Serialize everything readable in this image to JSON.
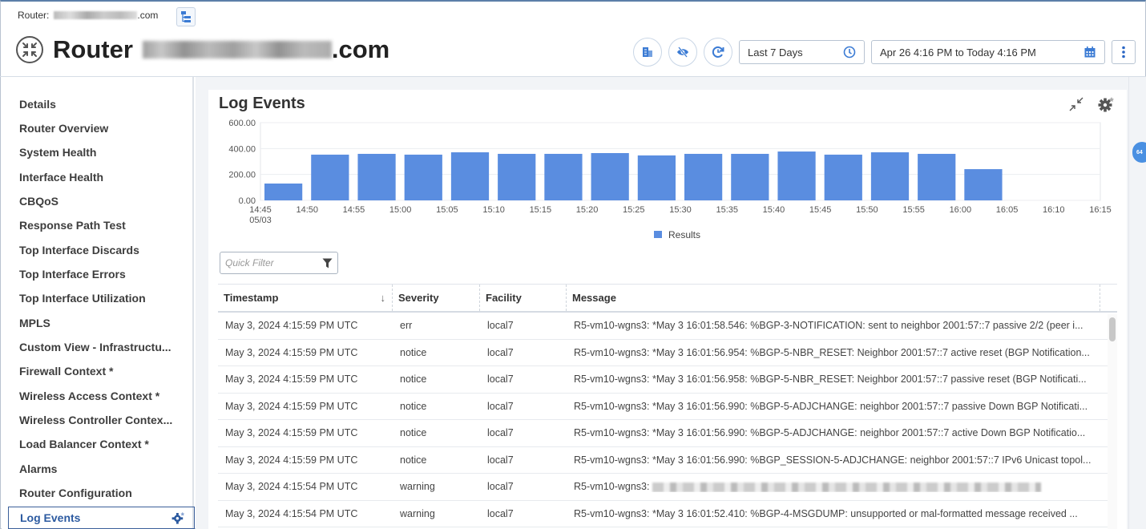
{
  "header": {
    "breadcrumb_prefix": "Router:",
    "breadcrumb_suffix": ".com",
    "title_prefix": "Router",
    "title_suffix": ".com",
    "time_range_select": "Last 7 Days",
    "date_range": "Apr 26 4:16 PM to Today 4:16 PM",
    "icons": [
      "topology-icon",
      "router-icon",
      "report-icon",
      "hide-icon",
      "refresh-schedule-icon",
      "clock-icon",
      "calendar-icon",
      "more-vertical-icon"
    ]
  },
  "sidebar": {
    "items": [
      {
        "label": "Details"
      },
      {
        "label": "Router Overview"
      },
      {
        "label": "System Health"
      },
      {
        "label": "Interface Health"
      },
      {
        "label": "CBQoS"
      },
      {
        "label": "Response Path Test"
      },
      {
        "label": "Top Interface Discards"
      },
      {
        "label": "Top Interface Errors"
      },
      {
        "label": "Top Interface Utilization"
      },
      {
        "label": "MPLS"
      },
      {
        "label": "Custom View - Infrastructu..."
      },
      {
        "label": "Firewall Context *"
      },
      {
        "label": "Wireless Access Context *"
      },
      {
        "label": "Wireless Controller Contex..."
      },
      {
        "label": "Load Balancer Context *"
      },
      {
        "label": "Alarms"
      },
      {
        "label": "Router Configuration"
      },
      {
        "label": "Log Events",
        "active": true
      }
    ]
  },
  "panel": {
    "title": "Log Events",
    "quick_filter_placeholder": "Quick Filter",
    "side_badge": "64"
  },
  "chart_data": {
    "type": "bar",
    "title": "Log Events",
    "categories": [
      "14:45",
      "14:50",
      "14:55",
      "15:00",
      "15:05",
      "15:10",
      "15:15",
      "15:20",
      "15:25",
      "15:30",
      "15:35",
      "15:40",
      "15:45",
      "15:50",
      "15:55"
    ],
    "x_tick_labels": [
      "14:45",
      "14:50",
      "14:55",
      "15:00",
      "15:05",
      "15:10",
      "15:15",
      "15:20",
      "15:25",
      "15:30",
      "15:35",
      "15:40",
      "15:45",
      "15:50",
      "15:55",
      "16:00",
      "16:05",
      "16:10",
      "16:15"
    ],
    "x_date_label": "05/03",
    "series": [
      {
        "name": "Results",
        "color": "#5a8de0",
        "values": [
          130,
          353,
          359,
          353,
          371,
          359,
          359,
          365,
          347,
          359,
          359,
          377,
          353,
          371,
          359,
          241
        ]
      }
    ],
    "bar_times": [
      "14:45",
      "14:50",
      "14:55",
      "15:00",
      "15:05",
      "15:10",
      "15:15",
      "15:20",
      "15:25",
      "15:30",
      "15:35",
      "15:40",
      "15:45",
      "15:50",
      "15:55",
      "16:00",
      "16:05",
      "16:10"
    ],
    "y_ticks": [
      "0.00",
      "200.00",
      "400.00",
      "600.00"
    ],
    "ylim": [
      0,
      600
    ],
    "xlabel": "",
    "ylabel": "",
    "grid": true,
    "legend": "bottom-center"
  },
  "table": {
    "columns": [
      "Timestamp",
      "Severity",
      "Facility",
      "Message"
    ],
    "sort_column": "Timestamp",
    "sort_direction": "descending",
    "rows": [
      {
        "timestamp": "May 3, 2024 4:15:59 PM UTC",
        "severity": "err",
        "facility": "local7",
        "message": "R5-vm10-wgns3: *May 3 16:01:58.546: %BGP-3-NOTIFICATION: sent to neighbor 2001:57::7 passive 2/2 (peer i..."
      },
      {
        "timestamp": "May 3, 2024 4:15:59 PM UTC",
        "severity": "notice",
        "facility": "local7",
        "message": "R5-vm10-wgns3: *May 3 16:01:56.954: %BGP-5-NBR_RESET: Neighbor 2001:57::7 active reset (BGP Notification..."
      },
      {
        "timestamp": "May 3, 2024 4:15:59 PM UTC",
        "severity": "notice",
        "facility": "local7",
        "message": "R5-vm10-wgns3: *May 3 16:01:56.958: %BGP-5-NBR_RESET: Neighbor 2001:57::7 passive reset (BGP Notificati..."
      },
      {
        "timestamp": "May 3, 2024 4:15:59 PM UTC",
        "severity": "notice",
        "facility": "local7",
        "message": "R5-vm10-wgns3: *May 3 16:01:56.990: %BGP-5-ADJCHANGE: neighbor 2001:57::7 passive Down BGP Notificati..."
      },
      {
        "timestamp": "May 3, 2024 4:15:59 PM UTC",
        "severity": "notice",
        "facility": "local7",
        "message": "R5-vm10-wgns3: *May 3 16:01:56.990: %BGP-5-ADJCHANGE: neighbor 2001:57::7 active Down BGP Notificatio..."
      },
      {
        "timestamp": "May 3, 2024 4:15:59 PM UTC",
        "severity": "notice",
        "facility": "local7",
        "message": "R5-vm10-wgns3: *May 3 16:01:56.990: %BGP_SESSION-5-ADJCHANGE: neighbor 2001:57::7 IPv6 Unicast topol..."
      },
      {
        "timestamp": "May 3, 2024 4:15:54 PM UTC",
        "severity": "warning",
        "facility": "local7",
        "message": "R5-vm10-wgns3:",
        "redacted": true
      },
      {
        "timestamp": "May 3, 2024 4:15:54 PM UTC",
        "severity": "warning",
        "facility": "local7",
        "message": "R5-vm10-wgns3: *May 3 16:01:52.410: %BGP-4-MSGDUMP: unsupported or mal-formatted message received ..."
      }
    ]
  },
  "colors": {
    "accent": "#3b7bd4",
    "bar": "#5a8de0",
    "active_nav": "#2c5aa0",
    "badge": "#4a90e2"
  }
}
